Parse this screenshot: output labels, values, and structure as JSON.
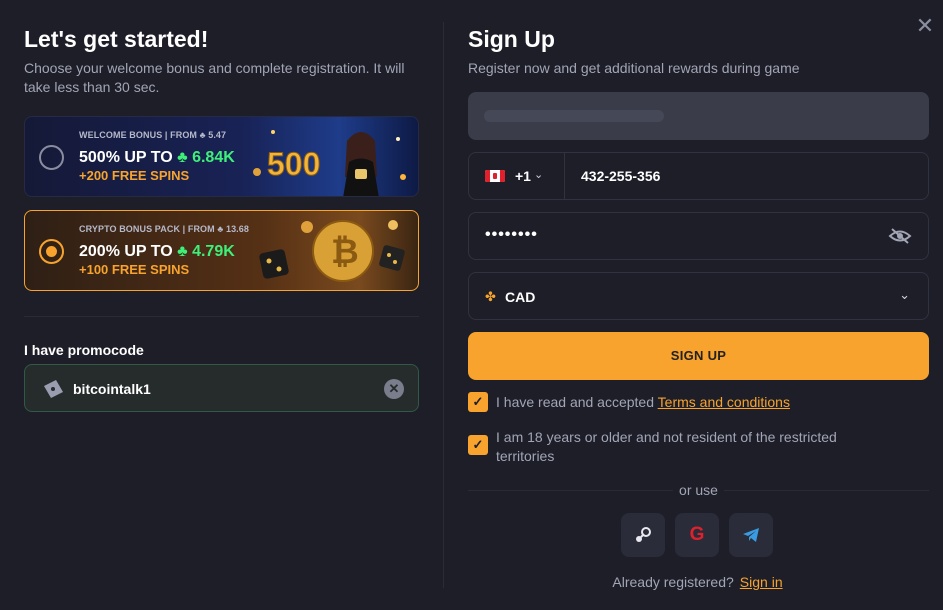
{
  "left": {
    "title": "Let's get started!",
    "subtitle": "Choose your welcome bonus and complete registration. It will take less than 30 sec.",
    "bonuses": [
      {
        "small": "WELCOME BONUS | FROM ♣ 5.47",
        "main_prefix": "500% UP TO",
        "main_amount": "♣ 6.84K",
        "spins": "+200 FREE SPINS",
        "selected": false
      },
      {
        "small": "CRYPTO BONUS PACK | FROM ♣ 13.68",
        "main_prefix": "200% UP TO",
        "main_amount": "♣ 4.79K",
        "spins": "+100 FREE SPINS",
        "selected": true
      }
    ],
    "promo_label": "I have promocode",
    "promo_value": "bitcointalk1"
  },
  "right": {
    "title": "Sign Up",
    "subtitle": "Register now and get additional rewards during game",
    "phone_code": "+1",
    "phone_value": "432-255-356",
    "password_mask": "••••••••",
    "currency": "CAD",
    "signup_label": "SIGN UP",
    "terms_prefix": "I have read and accepted",
    "terms_link": "Terms and conditions",
    "age_text": "I am 18 years or older and not resident of the restricted territories",
    "or_use": "or use",
    "already": "Already registered?",
    "sign_in": "Sign in"
  },
  "colors": {
    "accent": "#f7a32d",
    "green": "#3ef07a",
    "bg": "#1d1e28"
  }
}
